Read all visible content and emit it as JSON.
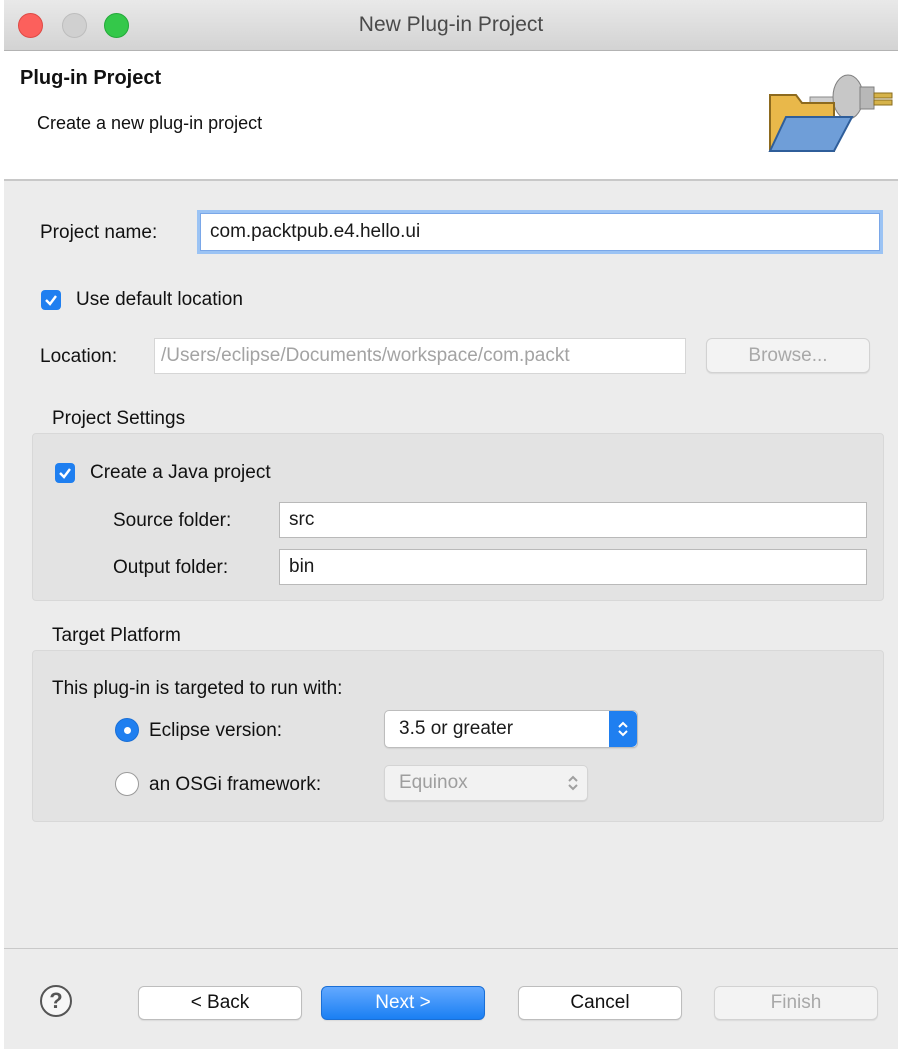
{
  "window": {
    "title": "New Plug-in Project"
  },
  "banner": {
    "title": "Plug-in Project",
    "description": "Create a new plug-in project",
    "icon": "folder-plugin-icon"
  },
  "project": {
    "name_label": "Project name:",
    "name_value": "com.packtpub.e4.hello.ui",
    "use_default_label": "Use default location",
    "use_default_checked": true,
    "location_label": "Location:",
    "location_value": "/Users/eclipse/Documents/workspace/com.packt",
    "browse_label": "Browse..."
  },
  "settings": {
    "group_title": "Project Settings",
    "java_label": "Create a Java project",
    "java_checked": true,
    "source_label": "Source folder:",
    "source_value": "src",
    "output_label": "Output folder:",
    "output_value": "bin"
  },
  "target": {
    "group_title": "Target Platform",
    "intro": "This plug-in is targeted to run with:",
    "eclipse_label": "Eclipse version:",
    "eclipse_selected": true,
    "eclipse_value": "3.5 or greater",
    "osgi_label": "an OSGi framework:",
    "osgi_value": "Equinox"
  },
  "buttons": {
    "back": "< Back",
    "next": "Next >",
    "cancel": "Cancel",
    "finish": "Finish"
  },
  "colors": {
    "accent": "#1f7ff0",
    "close": "#fc605c",
    "zoom": "#34c84a"
  }
}
